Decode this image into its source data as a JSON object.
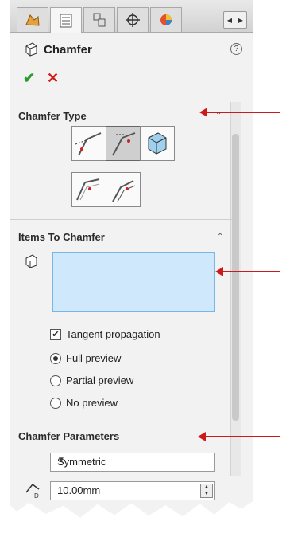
{
  "feature": {
    "title": "Chamfer",
    "help_symbol": "?"
  },
  "tabs": [
    {
      "name": "featuremanager",
      "active": false
    },
    {
      "name": "propertymanager",
      "active": true
    },
    {
      "name": "configurationmanager",
      "active": false
    },
    {
      "name": "dimxpertmanager",
      "active": false
    },
    {
      "name": "displaymanager",
      "active": false
    }
  ],
  "actions": {
    "ok_symbol": "✔",
    "cancel_symbol": "✕"
  },
  "chamfer_type": {
    "title": "Chamfer Type",
    "buttons": [
      {
        "icon": "angle-distance-chamfer-icon",
        "selected": false
      },
      {
        "icon": "distance-distance-chamfer-icon",
        "selected": true
      },
      {
        "icon": "vertex-chamfer-icon",
        "selected": false
      },
      {
        "icon": "offset-face-chamfer-icon",
        "selected": false
      },
      {
        "icon": "face-face-chamfer-icon",
        "selected": false
      }
    ]
  },
  "items_to_chamfer": {
    "title": "Items To Chamfer",
    "tangent_propagation": {
      "label": "Tangent propagation",
      "checked": true
    },
    "preview_options": [
      {
        "label": "Full preview",
        "selected": true
      },
      {
        "label": "Partial preview",
        "selected": false
      },
      {
        "label": "No preview",
        "selected": false
      }
    ]
  },
  "chamfer_parameters": {
    "title": "Chamfer Parameters",
    "mode_value": "Symmetric",
    "distance_value": "10.00mm"
  },
  "colors": {
    "callout": "#cc1a1a",
    "selection_box": "#cfe8fb",
    "ok": "#2a9b2a",
    "cancel": "#d01c1c"
  }
}
